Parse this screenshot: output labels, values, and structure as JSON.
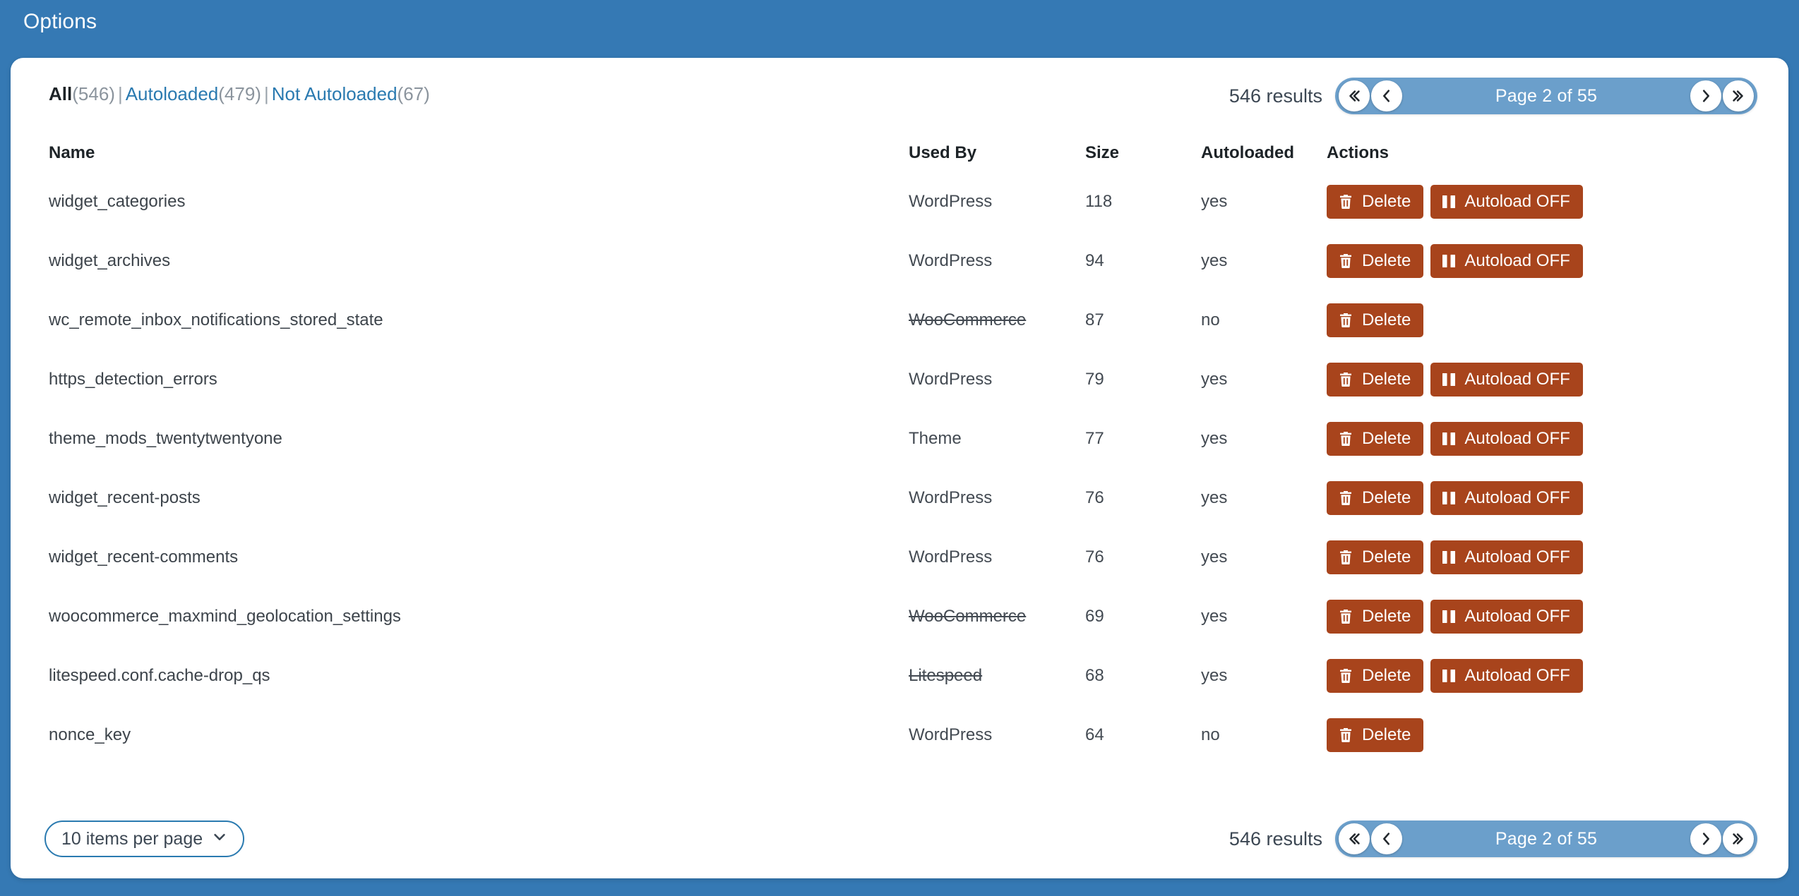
{
  "page": {
    "title": "Options",
    "accent_blue": "#3579b4",
    "pager_blue": "#6b9fcb",
    "button_orange": "#a8441c",
    "link_blue": "#2a7ab0"
  },
  "filters": {
    "items": [
      {
        "label": "All",
        "count": "(546)",
        "current": true
      },
      {
        "label": "Autoloaded",
        "count": "(479)",
        "current": false
      },
      {
        "label": "Not Autoloaded",
        "count": "(67)",
        "current": false
      }
    ],
    "separator": "|"
  },
  "pagination": {
    "results_label": "546 results",
    "page_label": "Page 2 of 55",
    "first_icon": "double-chevron-left-icon",
    "prev_icon": "chevron-left-icon",
    "next_icon": "chevron-right-icon",
    "last_icon": "double-chevron-right-icon"
  },
  "table": {
    "headers": {
      "name": "Name",
      "used_by": "Used By",
      "size": "Size",
      "autoloaded": "Autoloaded",
      "actions": "Actions"
    },
    "rows": [
      {
        "name": "widget_categories",
        "used_by": "WordPress",
        "used_by_inactive": false,
        "size": "118",
        "autoloaded": "yes",
        "has_autoload_toggle": true
      },
      {
        "name": "widget_archives",
        "used_by": "WordPress",
        "used_by_inactive": false,
        "size": "94",
        "autoloaded": "yes",
        "has_autoload_toggle": true
      },
      {
        "name": "wc_remote_inbox_notifications_stored_state",
        "used_by": "WooCommerce",
        "used_by_inactive": true,
        "size": "87",
        "autoloaded": "no",
        "has_autoload_toggle": false
      },
      {
        "name": "https_detection_errors",
        "used_by": "WordPress",
        "used_by_inactive": false,
        "size": "79",
        "autoloaded": "yes",
        "has_autoload_toggle": true
      },
      {
        "name": "theme_mods_twentytwentyone",
        "used_by": "Theme",
        "used_by_inactive": false,
        "size": "77",
        "autoloaded": "yes",
        "has_autoload_toggle": true
      },
      {
        "name": "widget_recent-posts",
        "used_by": "WordPress",
        "used_by_inactive": false,
        "size": "76",
        "autoloaded": "yes",
        "has_autoload_toggle": true
      },
      {
        "name": "widget_recent-comments",
        "used_by": "WordPress",
        "used_by_inactive": false,
        "size": "76",
        "autoloaded": "yes",
        "has_autoload_toggle": true
      },
      {
        "name": "woocommerce_maxmind_geolocation_settings",
        "used_by": "WooCommerce",
        "used_by_inactive": true,
        "size": "69",
        "autoloaded": "yes",
        "has_autoload_toggle": true
      },
      {
        "name": "litespeed.conf.cache-drop_qs",
        "used_by": "Litespeed",
        "used_by_inactive": true,
        "size": "68",
        "autoloaded": "yes",
        "has_autoload_toggle": true
      },
      {
        "name": "nonce_key",
        "used_by": "WordPress",
        "used_by_inactive": false,
        "size": "64",
        "autoloaded": "no",
        "has_autoload_toggle": false
      }
    ],
    "actions": {
      "delete_label": "Delete",
      "delete_icon": "trash-icon",
      "autoload_off_label": "Autoload OFF",
      "autoload_off_icon": "pause-icon"
    }
  },
  "footer": {
    "per_page_label": "10 items per page",
    "per_page_icon": "chevron-down-icon",
    "results_label": "546 results",
    "page_label": "Page 2 of 55"
  }
}
